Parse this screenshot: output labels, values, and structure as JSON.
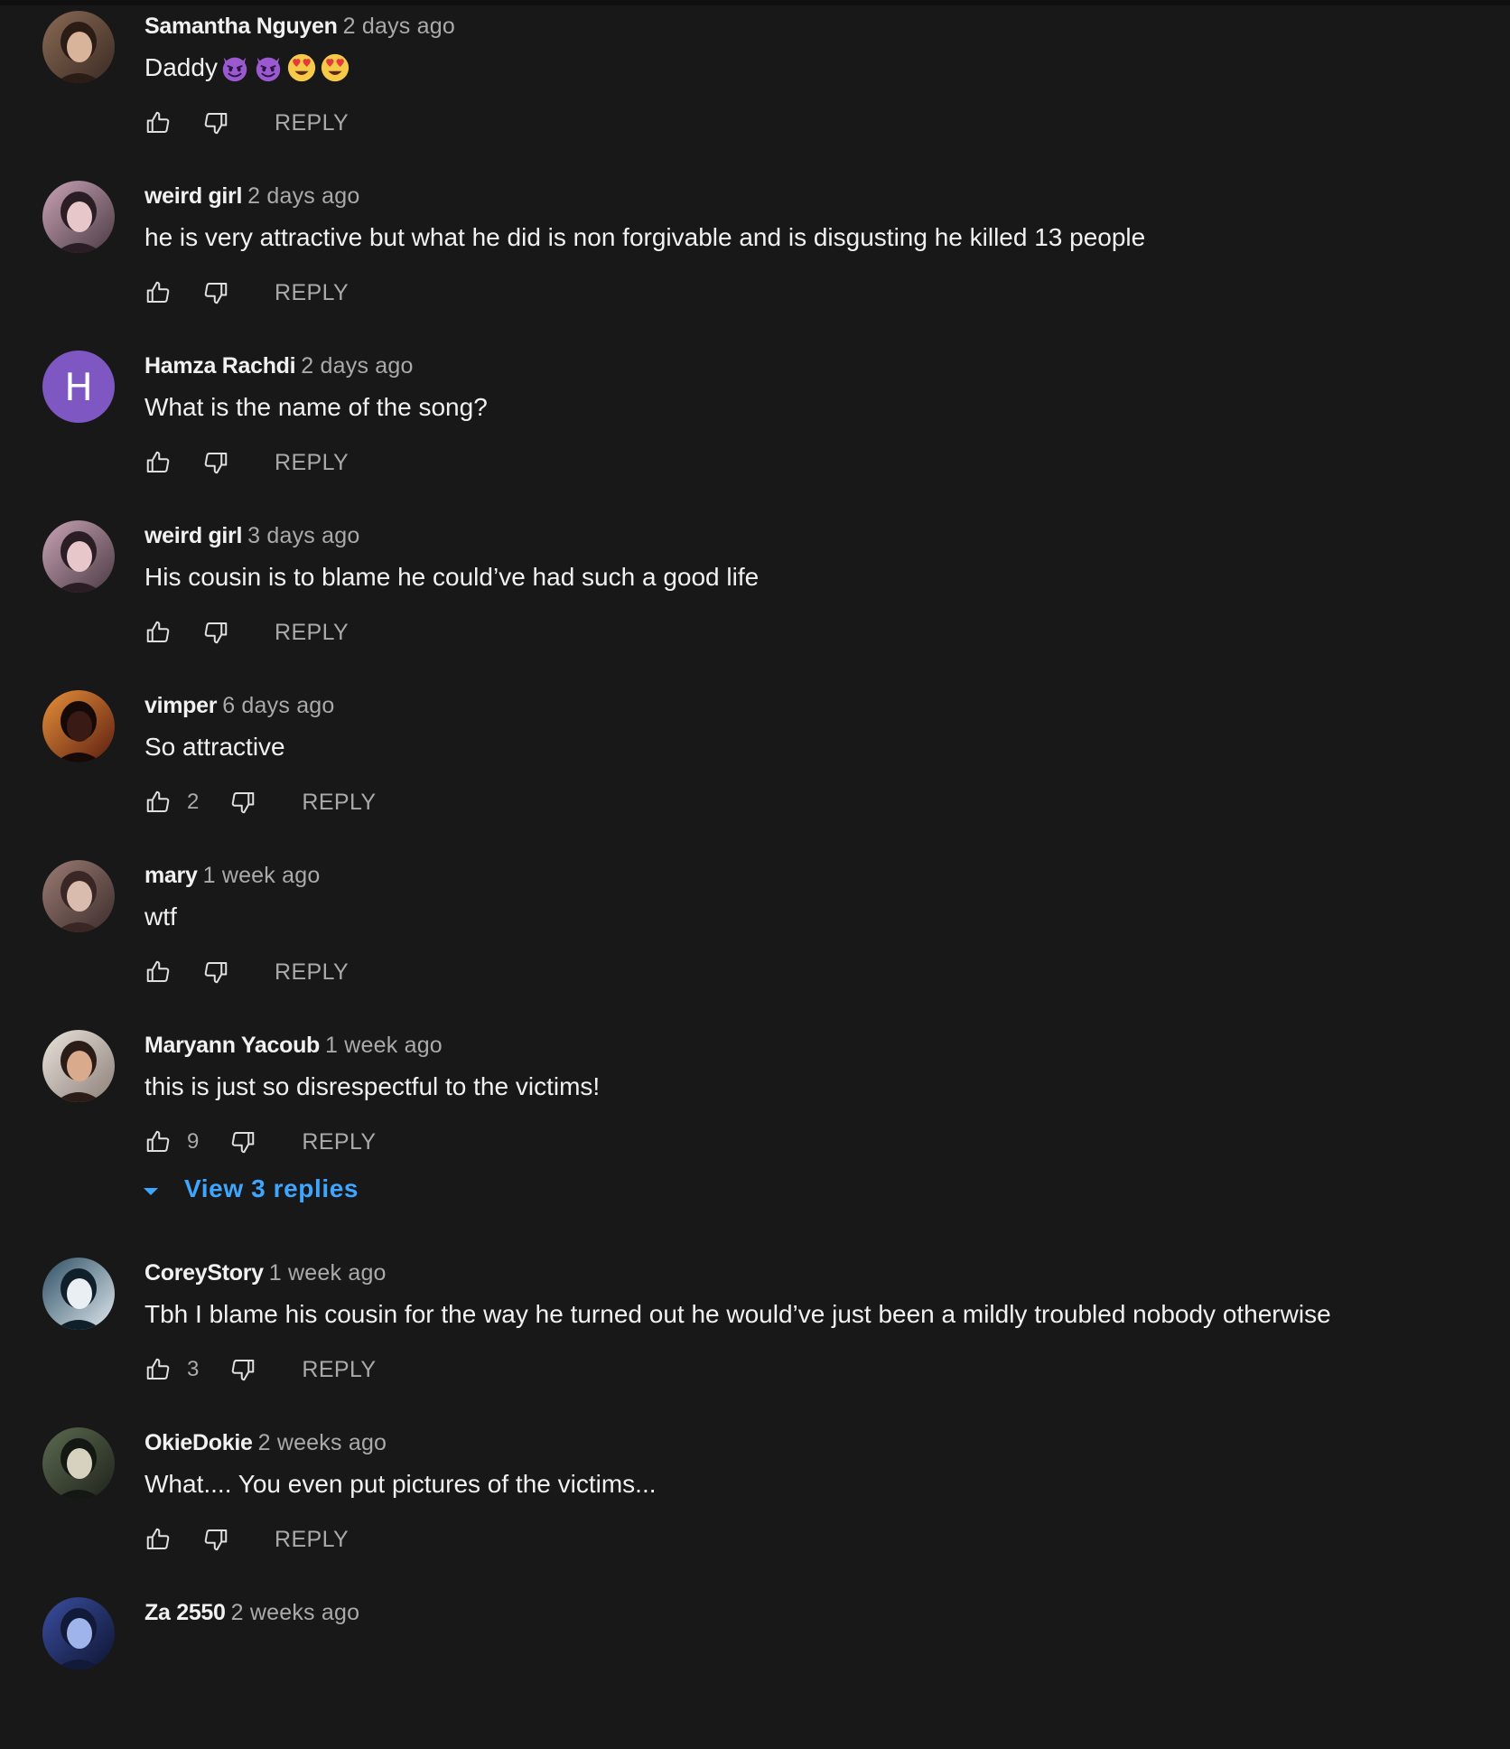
{
  "reply_label": "REPLY",
  "accent_color": "#3ea6ff",
  "comments": [
    {
      "author": "Samantha Nguyen",
      "time": "2 days ago",
      "text": "Daddy",
      "emojis": [
        "smiling-imp-emoji",
        "smiling-imp-emoji",
        "heart-eyes-emoji",
        "heart-eyes-emoji"
      ],
      "likes": "",
      "avatar": "photo"
    },
    {
      "author": "weird girl",
      "time": "2 days ago",
      "text": "he is very attractive but what he did is non forgivable and is disgusting he killed 13 people",
      "likes": "",
      "avatar": "photo"
    },
    {
      "author": "Hamza Rachdi",
      "time": "2 days ago",
      "text": "What is the name of the song?",
      "likes": "",
      "avatar": "letter",
      "avatar_letter": "H",
      "avatar_color": "#7e57c2"
    },
    {
      "author": "weird girl",
      "time": "3 days ago",
      "text": "His cousin is to blame he could’ve had such a good life",
      "likes": "",
      "avatar": "photo"
    },
    {
      "author": "vimper",
      "time": "6 days ago",
      "text": "So attractive",
      "likes": "2",
      "avatar": "photo"
    },
    {
      "author": "mary",
      "time": "1 week ago",
      "text": "wtf",
      "likes": "",
      "avatar": "photo"
    },
    {
      "author": "Maryann Yacoub",
      "time": "1 week ago",
      "text": "this is just so disrespectful to the victims!",
      "likes": "9",
      "view_replies": "View 3 replies",
      "avatar": "photo"
    },
    {
      "author": "CoreyStory",
      "time": "1 week ago",
      "text": "Tbh I blame his cousin for the way he turned out he would’ve just been a mildly troubled nobody otherwise",
      "likes": "3",
      "avatar": "photo"
    },
    {
      "author": "OkieDokie",
      "time": "2 weeks ago",
      "text": "What.... You even put pictures of the victims...",
      "likes": "",
      "avatar": "photo"
    },
    {
      "author": "Za 2550",
      "time": "2 weeks ago",
      "text": "",
      "likes": "",
      "avatar": "photo"
    }
  ]
}
